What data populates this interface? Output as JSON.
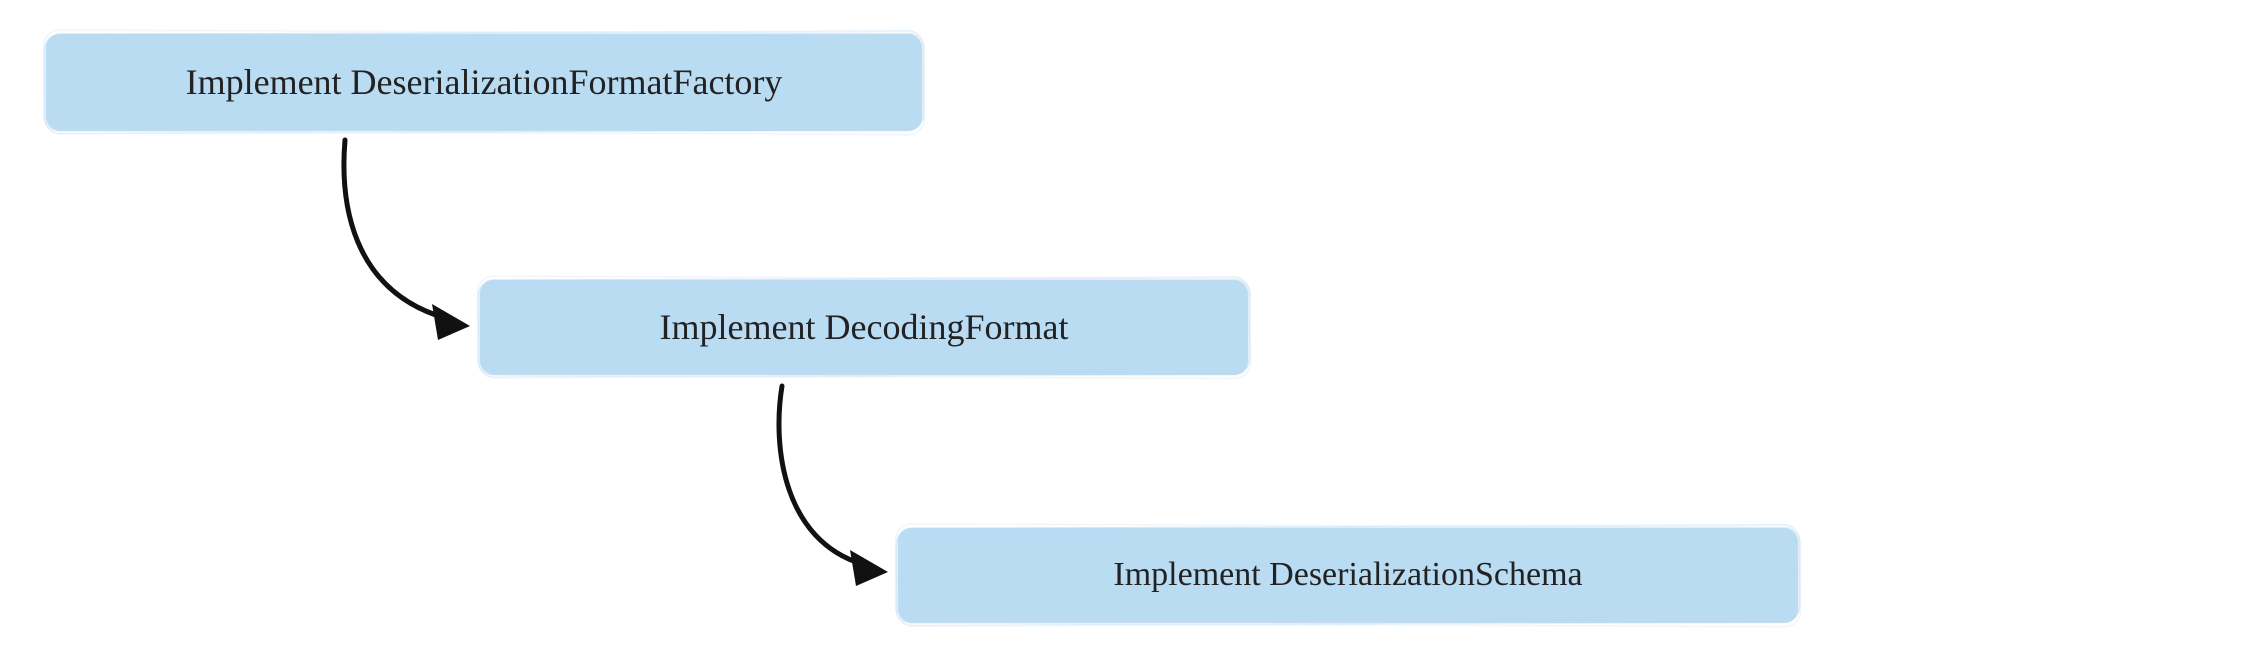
{
  "diagram": {
    "nodes": {
      "step1": {
        "label": "Implement DeserializationFormatFactory"
      },
      "step2": {
        "label": "Implement DecodingFormat"
      },
      "step3": {
        "label": "Implement DeserializationSchema"
      }
    },
    "edges": [
      {
        "from": "step1",
        "to": "step2"
      },
      {
        "from": "step2",
        "to": "step3"
      }
    ],
    "style": {
      "node_fill": "#b9dcf3",
      "arrow_color": "#111111",
      "background": "#ffffff",
      "hand_drawn": true
    }
  }
}
